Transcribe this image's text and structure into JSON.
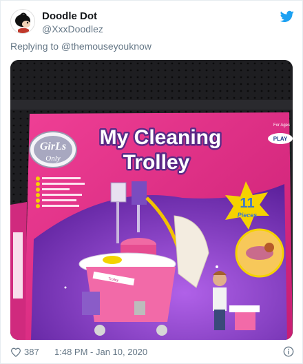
{
  "tweet": {
    "display_name": "Doodle Dot",
    "handle": "@XxxDoodlez",
    "replying_to": "Replying to @themouseyouknow",
    "likes": "387",
    "timestamp": "1:48 PM - Jan 10, 2020"
  },
  "photo": {
    "brand": "GirLs",
    "brand_sub": "Only",
    "title_line1": "My Cleaning",
    "title_line2": "Trolley",
    "pieces_number": "11",
    "pieces_label": "Pieces",
    "for_ages": "For Ages",
    "badge": "PLAY",
    "small_label": "Trolley"
  },
  "icons": {
    "bird": "twitter-bird-icon",
    "heart": "heart-icon",
    "info": "info-icon"
  },
  "colors": {
    "twitter_blue": "#1da1f2",
    "muted": "#657786",
    "box_pink": "#e0287f",
    "box_purple": "#7b2fb8",
    "pieces_yellow": "#f5d200"
  }
}
